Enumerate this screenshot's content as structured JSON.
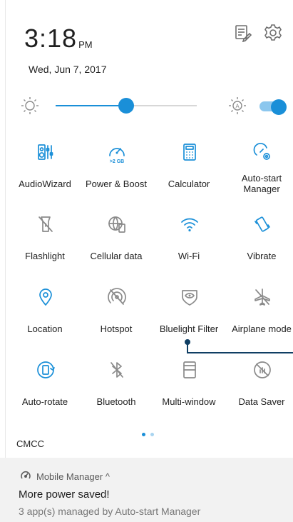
{
  "status": {
    "time": "3:18",
    "ampm": "PM",
    "date": "Wed, Jun 7, 2017"
  },
  "header_icons": [
    "edit-icon",
    "gear-icon"
  ],
  "brightness": {
    "level": 0.5,
    "auto": true
  },
  "tiles": [
    {
      "label": "AudioWizard",
      "icon": "audio-wizard-icon",
      "active": true
    },
    {
      "label": "Power & Boost",
      "icon": "power-boost-icon",
      "active": true,
      "badge": ">2 GB"
    },
    {
      "label": "Calculator",
      "icon": "calculator-icon",
      "active": true
    },
    {
      "label": "Auto-start Manager",
      "icon": "auto-start-icon",
      "active": true
    },
    {
      "label": "Flashlight",
      "icon": "flashlight-icon",
      "active": false
    },
    {
      "label": "Cellular data",
      "icon": "cellular-data-icon",
      "active": false
    },
    {
      "label": "Wi-Fi",
      "icon": "wifi-icon",
      "active": true
    },
    {
      "label": "Vibrate",
      "icon": "vibrate-icon",
      "active": true
    },
    {
      "label": "Location",
      "icon": "location-icon",
      "active": true
    },
    {
      "label": "Hotspot",
      "icon": "hotspot-icon",
      "active": false
    },
    {
      "label": "Bluelight Filter",
      "icon": "bluelight-filter-icon",
      "active": false
    },
    {
      "label": "Airplane mode",
      "icon": "airplane-icon",
      "active": false
    },
    {
      "label": "Auto-rotate",
      "icon": "auto-rotate-icon",
      "active": true
    },
    {
      "label": "Bluetooth",
      "icon": "bluetooth-icon",
      "active": false
    },
    {
      "label": "Multi-window",
      "icon": "multi-window-icon",
      "active": false
    },
    {
      "label": "Data Saver",
      "icon": "data-saver-icon",
      "active": false
    }
  ],
  "page_dots": {
    "count": 2,
    "current": 0
  },
  "carrier": "CMCC",
  "notification": {
    "app": "Mobile Manager ^",
    "title": "More power saved!",
    "text": "3 app(s) managed by Auto-start Manager"
  },
  "colors": {
    "accent": "#1a8fd8",
    "inactive": "#8a8a8a",
    "text": "#1f1f1f"
  }
}
